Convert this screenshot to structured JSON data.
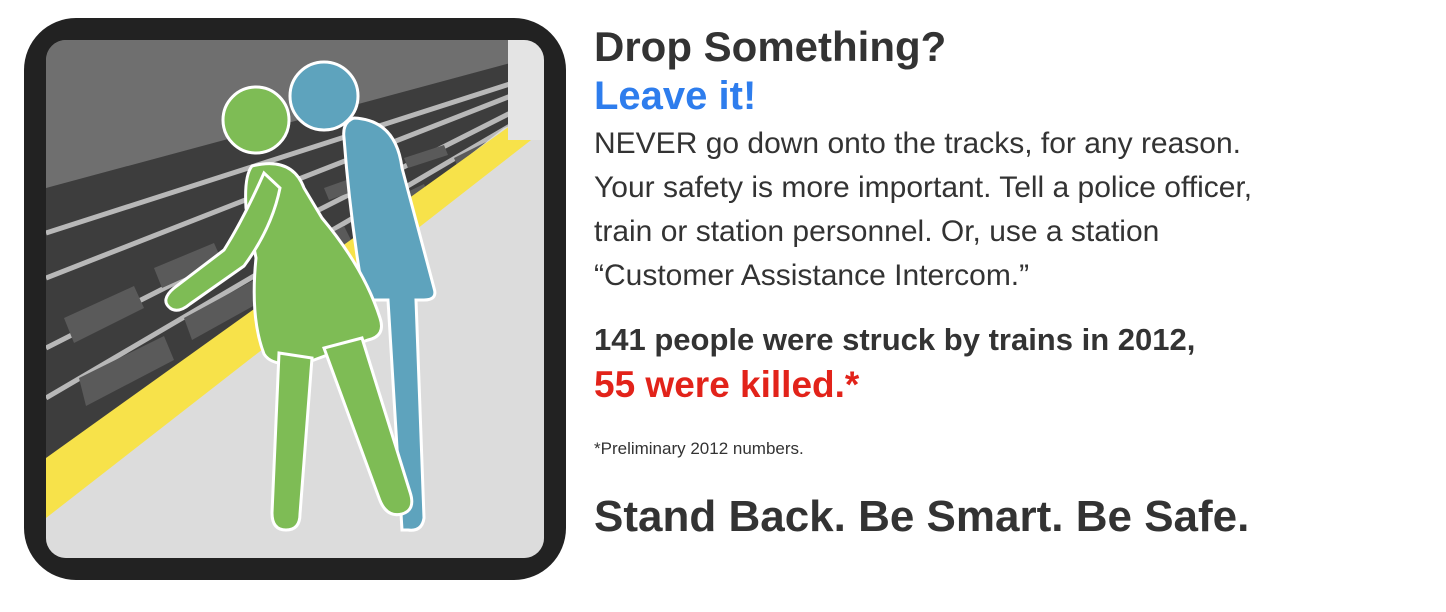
{
  "illustration": {
    "icon": "subway-platform-safety-icon",
    "colors": {
      "frame": "#222222",
      "platform_edge": "#f7e24a",
      "figure_woman": "#7ebc55",
      "figure_man": "#5ea3bd"
    }
  },
  "content": {
    "heading": "Drop Something?",
    "subheading": "Leave it!",
    "body_lines": [
      "NEVER go down onto the tracks, for any reason.",
      "Your safety is more important. Tell a police officer,",
      "train or station personnel. Or, use a station",
      "“Customer Assistance Intercom.”"
    ],
    "stat_line": "141 people were struck by trains in 2012,",
    "stat_highlight": "55 were killed.*",
    "footnote": "*Preliminary 2012 numbers.",
    "slogan": "Stand Back. Be Smart. Be Safe."
  },
  "colors": {
    "text": "#333333",
    "accent_blue": "#2e7ded",
    "accent_red": "#e2231a"
  }
}
